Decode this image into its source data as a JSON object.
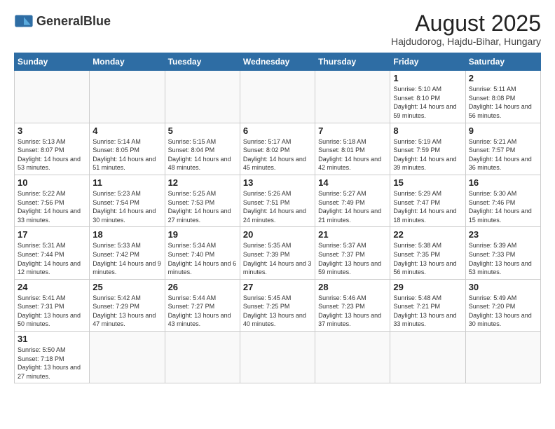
{
  "header": {
    "title": "August 2025",
    "subtitle": "Hajdudorog, Hajdu-Bihar, Hungary",
    "logo_text_normal": "General",
    "logo_text_bold": "Blue"
  },
  "days_of_week": [
    "Sunday",
    "Monday",
    "Tuesday",
    "Wednesday",
    "Thursday",
    "Friday",
    "Saturday"
  ],
  "weeks": [
    [
      {
        "day": "",
        "info": ""
      },
      {
        "day": "",
        "info": ""
      },
      {
        "day": "",
        "info": ""
      },
      {
        "day": "",
        "info": ""
      },
      {
        "day": "",
        "info": ""
      },
      {
        "day": "1",
        "info": "Sunrise: 5:10 AM\nSunset: 8:10 PM\nDaylight: 14 hours and 59 minutes."
      },
      {
        "day": "2",
        "info": "Sunrise: 5:11 AM\nSunset: 8:08 PM\nDaylight: 14 hours and 56 minutes."
      }
    ],
    [
      {
        "day": "3",
        "info": "Sunrise: 5:13 AM\nSunset: 8:07 PM\nDaylight: 14 hours and 53 minutes."
      },
      {
        "day": "4",
        "info": "Sunrise: 5:14 AM\nSunset: 8:05 PM\nDaylight: 14 hours and 51 minutes."
      },
      {
        "day": "5",
        "info": "Sunrise: 5:15 AM\nSunset: 8:04 PM\nDaylight: 14 hours and 48 minutes."
      },
      {
        "day": "6",
        "info": "Sunrise: 5:17 AM\nSunset: 8:02 PM\nDaylight: 14 hours and 45 minutes."
      },
      {
        "day": "7",
        "info": "Sunrise: 5:18 AM\nSunset: 8:01 PM\nDaylight: 14 hours and 42 minutes."
      },
      {
        "day": "8",
        "info": "Sunrise: 5:19 AM\nSunset: 7:59 PM\nDaylight: 14 hours and 39 minutes."
      },
      {
        "day": "9",
        "info": "Sunrise: 5:21 AM\nSunset: 7:57 PM\nDaylight: 14 hours and 36 minutes."
      }
    ],
    [
      {
        "day": "10",
        "info": "Sunrise: 5:22 AM\nSunset: 7:56 PM\nDaylight: 14 hours and 33 minutes."
      },
      {
        "day": "11",
        "info": "Sunrise: 5:23 AM\nSunset: 7:54 PM\nDaylight: 14 hours and 30 minutes."
      },
      {
        "day": "12",
        "info": "Sunrise: 5:25 AM\nSunset: 7:53 PM\nDaylight: 14 hours and 27 minutes."
      },
      {
        "day": "13",
        "info": "Sunrise: 5:26 AM\nSunset: 7:51 PM\nDaylight: 14 hours and 24 minutes."
      },
      {
        "day": "14",
        "info": "Sunrise: 5:27 AM\nSunset: 7:49 PM\nDaylight: 14 hours and 21 minutes."
      },
      {
        "day": "15",
        "info": "Sunrise: 5:29 AM\nSunset: 7:47 PM\nDaylight: 14 hours and 18 minutes."
      },
      {
        "day": "16",
        "info": "Sunrise: 5:30 AM\nSunset: 7:46 PM\nDaylight: 14 hours and 15 minutes."
      }
    ],
    [
      {
        "day": "17",
        "info": "Sunrise: 5:31 AM\nSunset: 7:44 PM\nDaylight: 14 hours and 12 minutes."
      },
      {
        "day": "18",
        "info": "Sunrise: 5:33 AM\nSunset: 7:42 PM\nDaylight: 14 hours and 9 minutes."
      },
      {
        "day": "19",
        "info": "Sunrise: 5:34 AM\nSunset: 7:40 PM\nDaylight: 14 hours and 6 minutes."
      },
      {
        "day": "20",
        "info": "Sunrise: 5:35 AM\nSunset: 7:39 PM\nDaylight: 14 hours and 3 minutes."
      },
      {
        "day": "21",
        "info": "Sunrise: 5:37 AM\nSunset: 7:37 PM\nDaylight: 13 hours and 59 minutes."
      },
      {
        "day": "22",
        "info": "Sunrise: 5:38 AM\nSunset: 7:35 PM\nDaylight: 13 hours and 56 minutes."
      },
      {
        "day": "23",
        "info": "Sunrise: 5:39 AM\nSunset: 7:33 PM\nDaylight: 13 hours and 53 minutes."
      }
    ],
    [
      {
        "day": "24",
        "info": "Sunrise: 5:41 AM\nSunset: 7:31 PM\nDaylight: 13 hours and 50 minutes."
      },
      {
        "day": "25",
        "info": "Sunrise: 5:42 AM\nSunset: 7:29 PM\nDaylight: 13 hours and 47 minutes."
      },
      {
        "day": "26",
        "info": "Sunrise: 5:44 AM\nSunset: 7:27 PM\nDaylight: 13 hours and 43 minutes."
      },
      {
        "day": "27",
        "info": "Sunrise: 5:45 AM\nSunset: 7:25 PM\nDaylight: 13 hours and 40 minutes."
      },
      {
        "day": "28",
        "info": "Sunrise: 5:46 AM\nSunset: 7:23 PM\nDaylight: 13 hours and 37 minutes."
      },
      {
        "day": "29",
        "info": "Sunrise: 5:48 AM\nSunset: 7:21 PM\nDaylight: 13 hours and 33 minutes."
      },
      {
        "day": "30",
        "info": "Sunrise: 5:49 AM\nSunset: 7:20 PM\nDaylight: 13 hours and 30 minutes."
      }
    ],
    [
      {
        "day": "31",
        "info": "Sunrise: 5:50 AM\nSunset: 7:18 PM\nDaylight: 13 hours and 27 minutes."
      },
      {
        "day": "",
        "info": ""
      },
      {
        "day": "",
        "info": ""
      },
      {
        "day": "",
        "info": ""
      },
      {
        "day": "",
        "info": ""
      },
      {
        "day": "",
        "info": ""
      },
      {
        "day": "",
        "info": ""
      }
    ]
  ]
}
